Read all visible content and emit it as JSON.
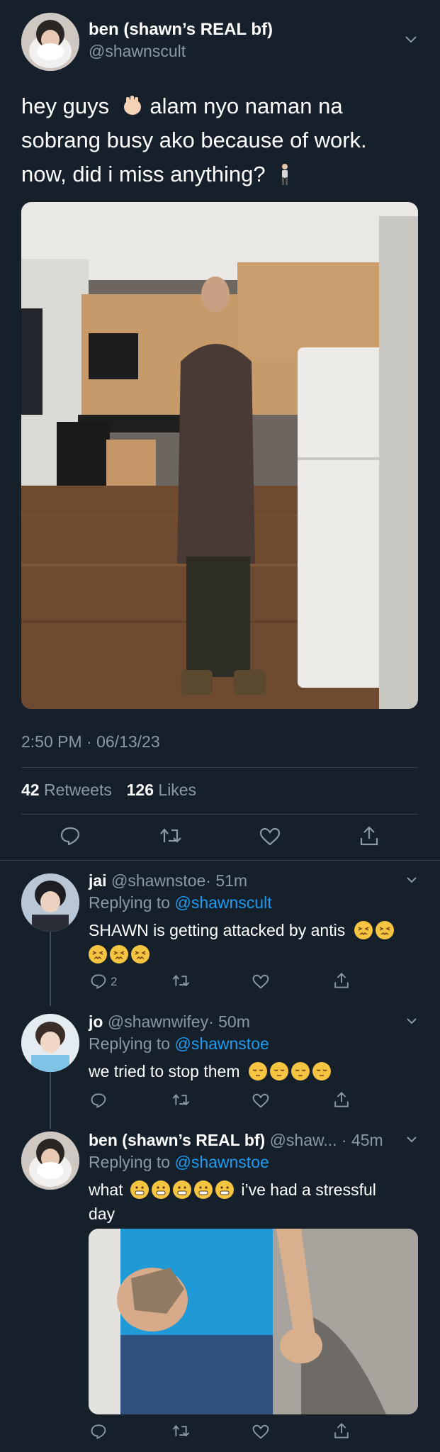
{
  "main_tweet": {
    "display_name": "ben (shawn’s REAL bf)",
    "handle": "@shawnscult",
    "text_lines": [
      "hey guys",
      "alam nyo naman na",
      "sobrang busy ako because of work.",
      "now, did i miss anything?"
    ],
    "timestamp": "2:50 PM · 06/13/23",
    "retweets_count": "42",
    "retweets_label": "Retweets",
    "likes_count": "126",
    "likes_label": "Likes"
  },
  "replies": [
    {
      "display_name": "jai",
      "handle": "@shawnstoe",
      "time": "· 51m",
      "replying_label": "Replying to",
      "replying_to": "@shawnscult",
      "text": "SHAWN is getting attacked by antis",
      "reply_count": "2"
    },
    {
      "display_name": "jo",
      "handle": "@shawnwifey",
      "time": "· 50m",
      "replying_label": "Replying to",
      "replying_to": "@shawnstoe",
      "text": "we tried to stop them"
    },
    {
      "display_name": "ben (shawn’s REAL bf)",
      "handle": "@shaw...",
      "time": "· 45m",
      "replying_label": "Replying to",
      "replying_to": "@shawnstoe",
      "text_prefix": "what",
      "text_suffix": "i’ve had a stressful",
      "text_line2": "day"
    }
  ],
  "icons": [
    "reply-icon",
    "retweet-icon",
    "like-icon",
    "share-icon",
    "chevron-down-icon"
  ],
  "colors": {
    "background": "#15202b",
    "muted": "#8b98a5",
    "link": "#1d9bf0",
    "divider": "#38444d"
  }
}
